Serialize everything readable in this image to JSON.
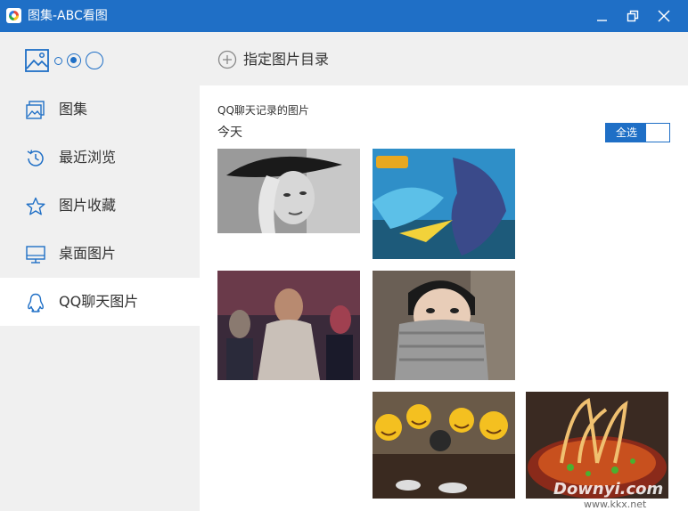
{
  "window": {
    "title": "图集-ABC看图",
    "controls": {
      "minimize_icon": "minimize-icon",
      "maximize_icon": "restore-icon",
      "close_icon": "close-icon"
    },
    "accent_color": "#1f6fc6"
  },
  "sidebar": {
    "view_switch_icon": "image-icon",
    "items": [
      {
        "label": "图集",
        "icon": "gallery-icon",
        "active": false
      },
      {
        "label": "最近浏览",
        "icon": "history-icon",
        "active": false
      },
      {
        "label": "图片收藏",
        "icon": "star-icon",
        "active": false
      },
      {
        "label": "桌面图片",
        "icon": "monitor-icon",
        "active": false
      },
      {
        "label": "QQ聊天图片",
        "icon": "qq-penguin-icon",
        "active": true
      }
    ]
  },
  "toolbar": {
    "add_directory_label": "指定图片目录",
    "add_icon": "plus-circle-icon"
  },
  "content": {
    "section_title": "QQ聊天记录的图片",
    "date_group": "今天",
    "select_all_label": "全选",
    "thumbnails": [
      {
        "name": "thumb-woman-hat",
        "color": "#8a8a8a"
      },
      {
        "name": "thumb-game-art",
        "color": "#2a8fc4"
      },
      {
        "name": "thumb-movie-poster",
        "color": "#3a2a3a"
      },
      {
        "name": "thumb-person-scarf",
        "color": "#6b5f55"
      },
      {
        "name": "thumb-emoji-party",
        "color": "#b89a6a"
      },
      {
        "name": "thumb-noodles",
        "color": "#c65a2a"
      }
    ]
  },
  "watermark": {
    "line1": "Downyi.com",
    "line2": "www.kkx.net"
  }
}
